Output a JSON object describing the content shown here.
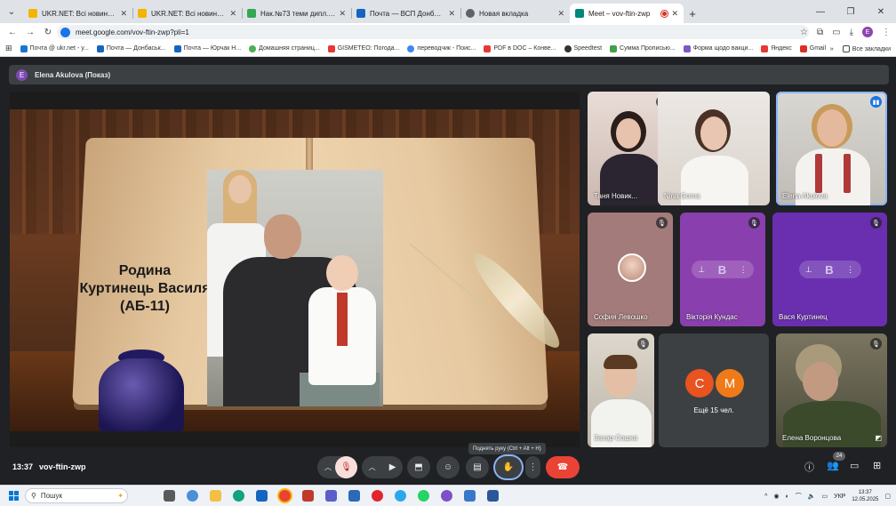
{
  "browser": {
    "tabs": [
      {
        "title": "UKR.NET: Всі новини України, ",
        "color": "#f4b400"
      },
      {
        "title": "UKR.NET: Всі новини України, ",
        "color": "#f4b400"
      },
      {
        "title": "Нак.№73 теми дипл. проектів",
        "color": "#34a853"
      },
      {
        "title": "Почта — ВСП Донбаський агр",
        "color": "#1565c0"
      },
      {
        "title": "Новая вкладка",
        "color": "#5f6368"
      },
      {
        "title": "Meet – vov-ftin-zwp",
        "color": "#00897b",
        "active": true
      }
    ],
    "url": "meet.google.com/vov-ftin-zwp?pli=1",
    "profile_initial": "E",
    "bookmarks": [
      {
        "label": "Почта @ ukr.net - у...",
        "color": "#1976d2"
      },
      {
        "label": "Почта — Донбаськ...",
        "color": "#1565c0"
      },
      {
        "label": "Почта — Юрчак Н...",
        "color": "#1565c0"
      },
      {
        "label": "Домашняя страниц...",
        "color": "#4caf50"
      },
      {
        "label": "GISMETEO: Погода...",
        "color": "#e53935"
      },
      {
        "label": "переводчик - Поис...",
        "color": "#4285f4"
      },
      {
        "label": "PDF в DOC – Конве...",
        "color": "#e53935"
      },
      {
        "label": "Speedtest",
        "color": "#333333"
      },
      {
        "label": "Сумма Прописью...",
        "color": "#43a047"
      },
      {
        "label": "Форма щодо вакци...",
        "color": "#7e57c2"
      },
      {
        "label": "Яндекс",
        "color": "#e53935"
      },
      {
        "label": "Gmail",
        "color": "#d93025"
      }
    ],
    "bookmarks_overflow": "»",
    "all_bookmarks": "Все закладки"
  },
  "meet": {
    "presenter_initial": "E",
    "presenter_banner": "Elena Akulova (Показ)",
    "slide_text": [
      "Родина",
      "Куртинець Василя",
      "(АБ-11)"
    ],
    "tiles": [
      {
        "name": "Таня Новик...",
        "muted": true
      },
      {
        "name": "Nina Goma",
        "muted": false
      },
      {
        "name": "Elena Akulova",
        "speaking": true
      },
      {
        "name": "София Левошко",
        "muted": true
      },
      {
        "name": "Вікторія Кундас",
        "muted": true,
        "letter": "B"
      },
      {
        "name": "Вася Куртинец",
        "muted": true,
        "letter": "B"
      },
      {
        "name": "Захар Сошка",
        "muted": true
      },
      {
        "name": "Елена Воронцова",
        "muted": true
      }
    ],
    "more": {
      "initials": [
        "С",
        "М"
      ],
      "label": "Ещё 15 чел."
    },
    "time": "13:37",
    "code": "vov-ftin-zwp",
    "tooltip": "Поднять руку (Ctrl + Alt + H)",
    "participant_count": "24"
  },
  "taskbar": {
    "search_label": "Пошук",
    "lang": "УКР",
    "time": "13:37",
    "date": "12.05.2025"
  }
}
